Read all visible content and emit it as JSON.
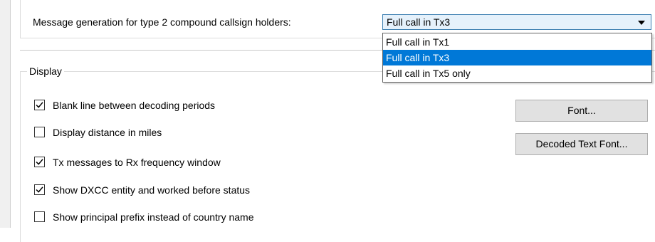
{
  "message_generation": {
    "label": "Message generation for type 2 compound callsign holders:",
    "selected_value": "Full call in Tx3",
    "options": [
      "Full call in Tx1",
      "Full call in Tx3",
      "Full call in Tx5 only"
    ],
    "highlighted_option_index": 1
  },
  "display": {
    "group_title": "Display",
    "checkboxes": [
      {
        "label": "Blank line between decoding periods",
        "checked": true
      },
      {
        "label": "Display distance in miles",
        "checked": false
      },
      {
        "label": "Tx messages to Rx frequency window",
        "checked": true
      },
      {
        "label": "Show DXCC entity and worked before status",
        "checked": true
      },
      {
        "label": "Show principal prefix instead of country name",
        "checked": false
      }
    ],
    "font_button_label": "Font...",
    "decoded_text_font_button_label": "Decoded Text Font..."
  },
  "colors": {
    "selection_highlight": "#0078d7",
    "combo_background": "#e5f1fb",
    "combo_border": "#3c7fb1",
    "button_background": "#e1e1e1"
  },
  "icons": {
    "checkmark": "checkmark-icon",
    "dropdown_arrow": "chevron-down-icon"
  }
}
